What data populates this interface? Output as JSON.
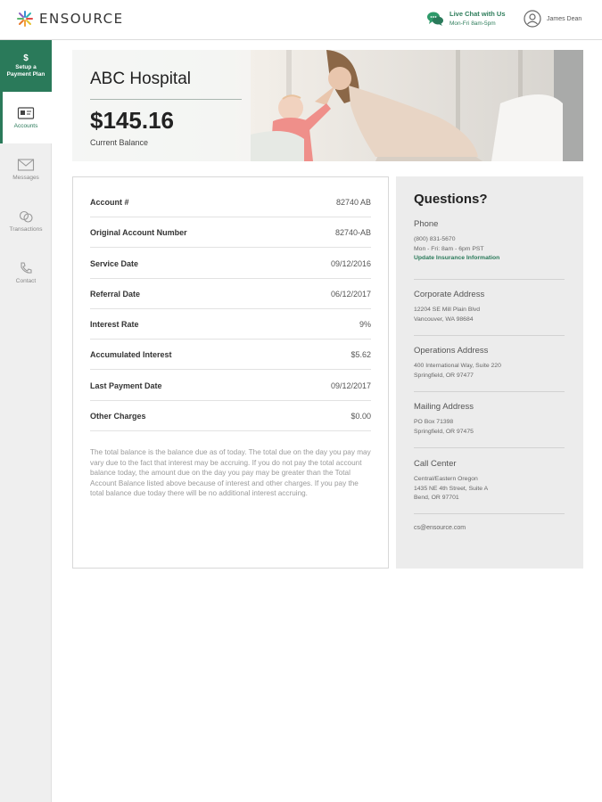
{
  "header": {
    "logo_text": "ENSOURCE",
    "live_chat_title": "Live Chat with Us",
    "live_chat_hours": "Mon-Fri 8am-5pm",
    "user_name": "James Dean"
  },
  "sidebar": {
    "payment_plan_symbol": "$",
    "payment_plan_label_1": "Setup a",
    "payment_plan_label_2": "Payment Plan",
    "items": [
      {
        "label": "Accounts",
        "icon": "accounts-icon",
        "active": true
      },
      {
        "label": "Messages",
        "icon": "envelope-icon",
        "active": false
      },
      {
        "label": "Transactions",
        "icon": "transactions-icon",
        "active": false
      },
      {
        "label": "Contact",
        "icon": "phone-icon",
        "active": false
      }
    ]
  },
  "banner": {
    "title": "ABC Hospital",
    "balance": "$145.16",
    "caption": "Current Balance"
  },
  "account": {
    "rows": [
      {
        "label": "Account #",
        "value": "82740 AB"
      },
      {
        "label": "Original Account Number",
        "value": "82740-AB"
      },
      {
        "label": "Service Date",
        "value": "09/12/2016"
      },
      {
        "label": "Referral Date",
        "value": "06/12/2017"
      },
      {
        "label": "Interest Rate",
        "value": "9%"
      },
      {
        "label": "Accumulated Interest",
        "value": "$5.62"
      },
      {
        "label": "Last Payment Date",
        "value": "09/12/2017"
      },
      {
        "label": "Other Charges",
        "value": "$0.00"
      }
    ],
    "disclaimer": "The total balance is the balance due as of today. The total due on the day you pay may vary due to the fact that interest may be accruing. If you do not pay the total account balance today, the amount due on the day you pay may be greater than the Total Account Balance listed above because of interest and other charges. If you pay the total balance due today there will be no additional interest accruing."
  },
  "questions": {
    "title": "Questions?",
    "phone": {
      "heading": "Phone",
      "number": "(800) 831-5670",
      "hours": "Mon - Fri: 8am - 6pm PST",
      "link": "Update Insurance Information"
    },
    "corporate": {
      "heading": "Corporate Address",
      "line1": "12204 SE Mill Plain Blvd",
      "line2": "Vancouver, WA 98684"
    },
    "operations": {
      "heading": "Operations Address",
      "line1": "400 International Way, Suite 220",
      "line2": "Springfield, OR 97477"
    },
    "mailing": {
      "heading": "Mailing Address",
      "line1": "PO Box 71398",
      "line2": "Springfield, OR 97475"
    },
    "call_center": {
      "heading": "Call Center",
      "line1": "Central/Eastern Oregon",
      "line2": "1435 NE 4th Street, Suite A",
      "line3": "Bend, OR 97701"
    },
    "email": "cs@ensource.com"
  },
  "colors": {
    "brand_green": "#2a7a5a",
    "sidebar_bg": "#efefef",
    "panel_bg": "#ececec"
  }
}
